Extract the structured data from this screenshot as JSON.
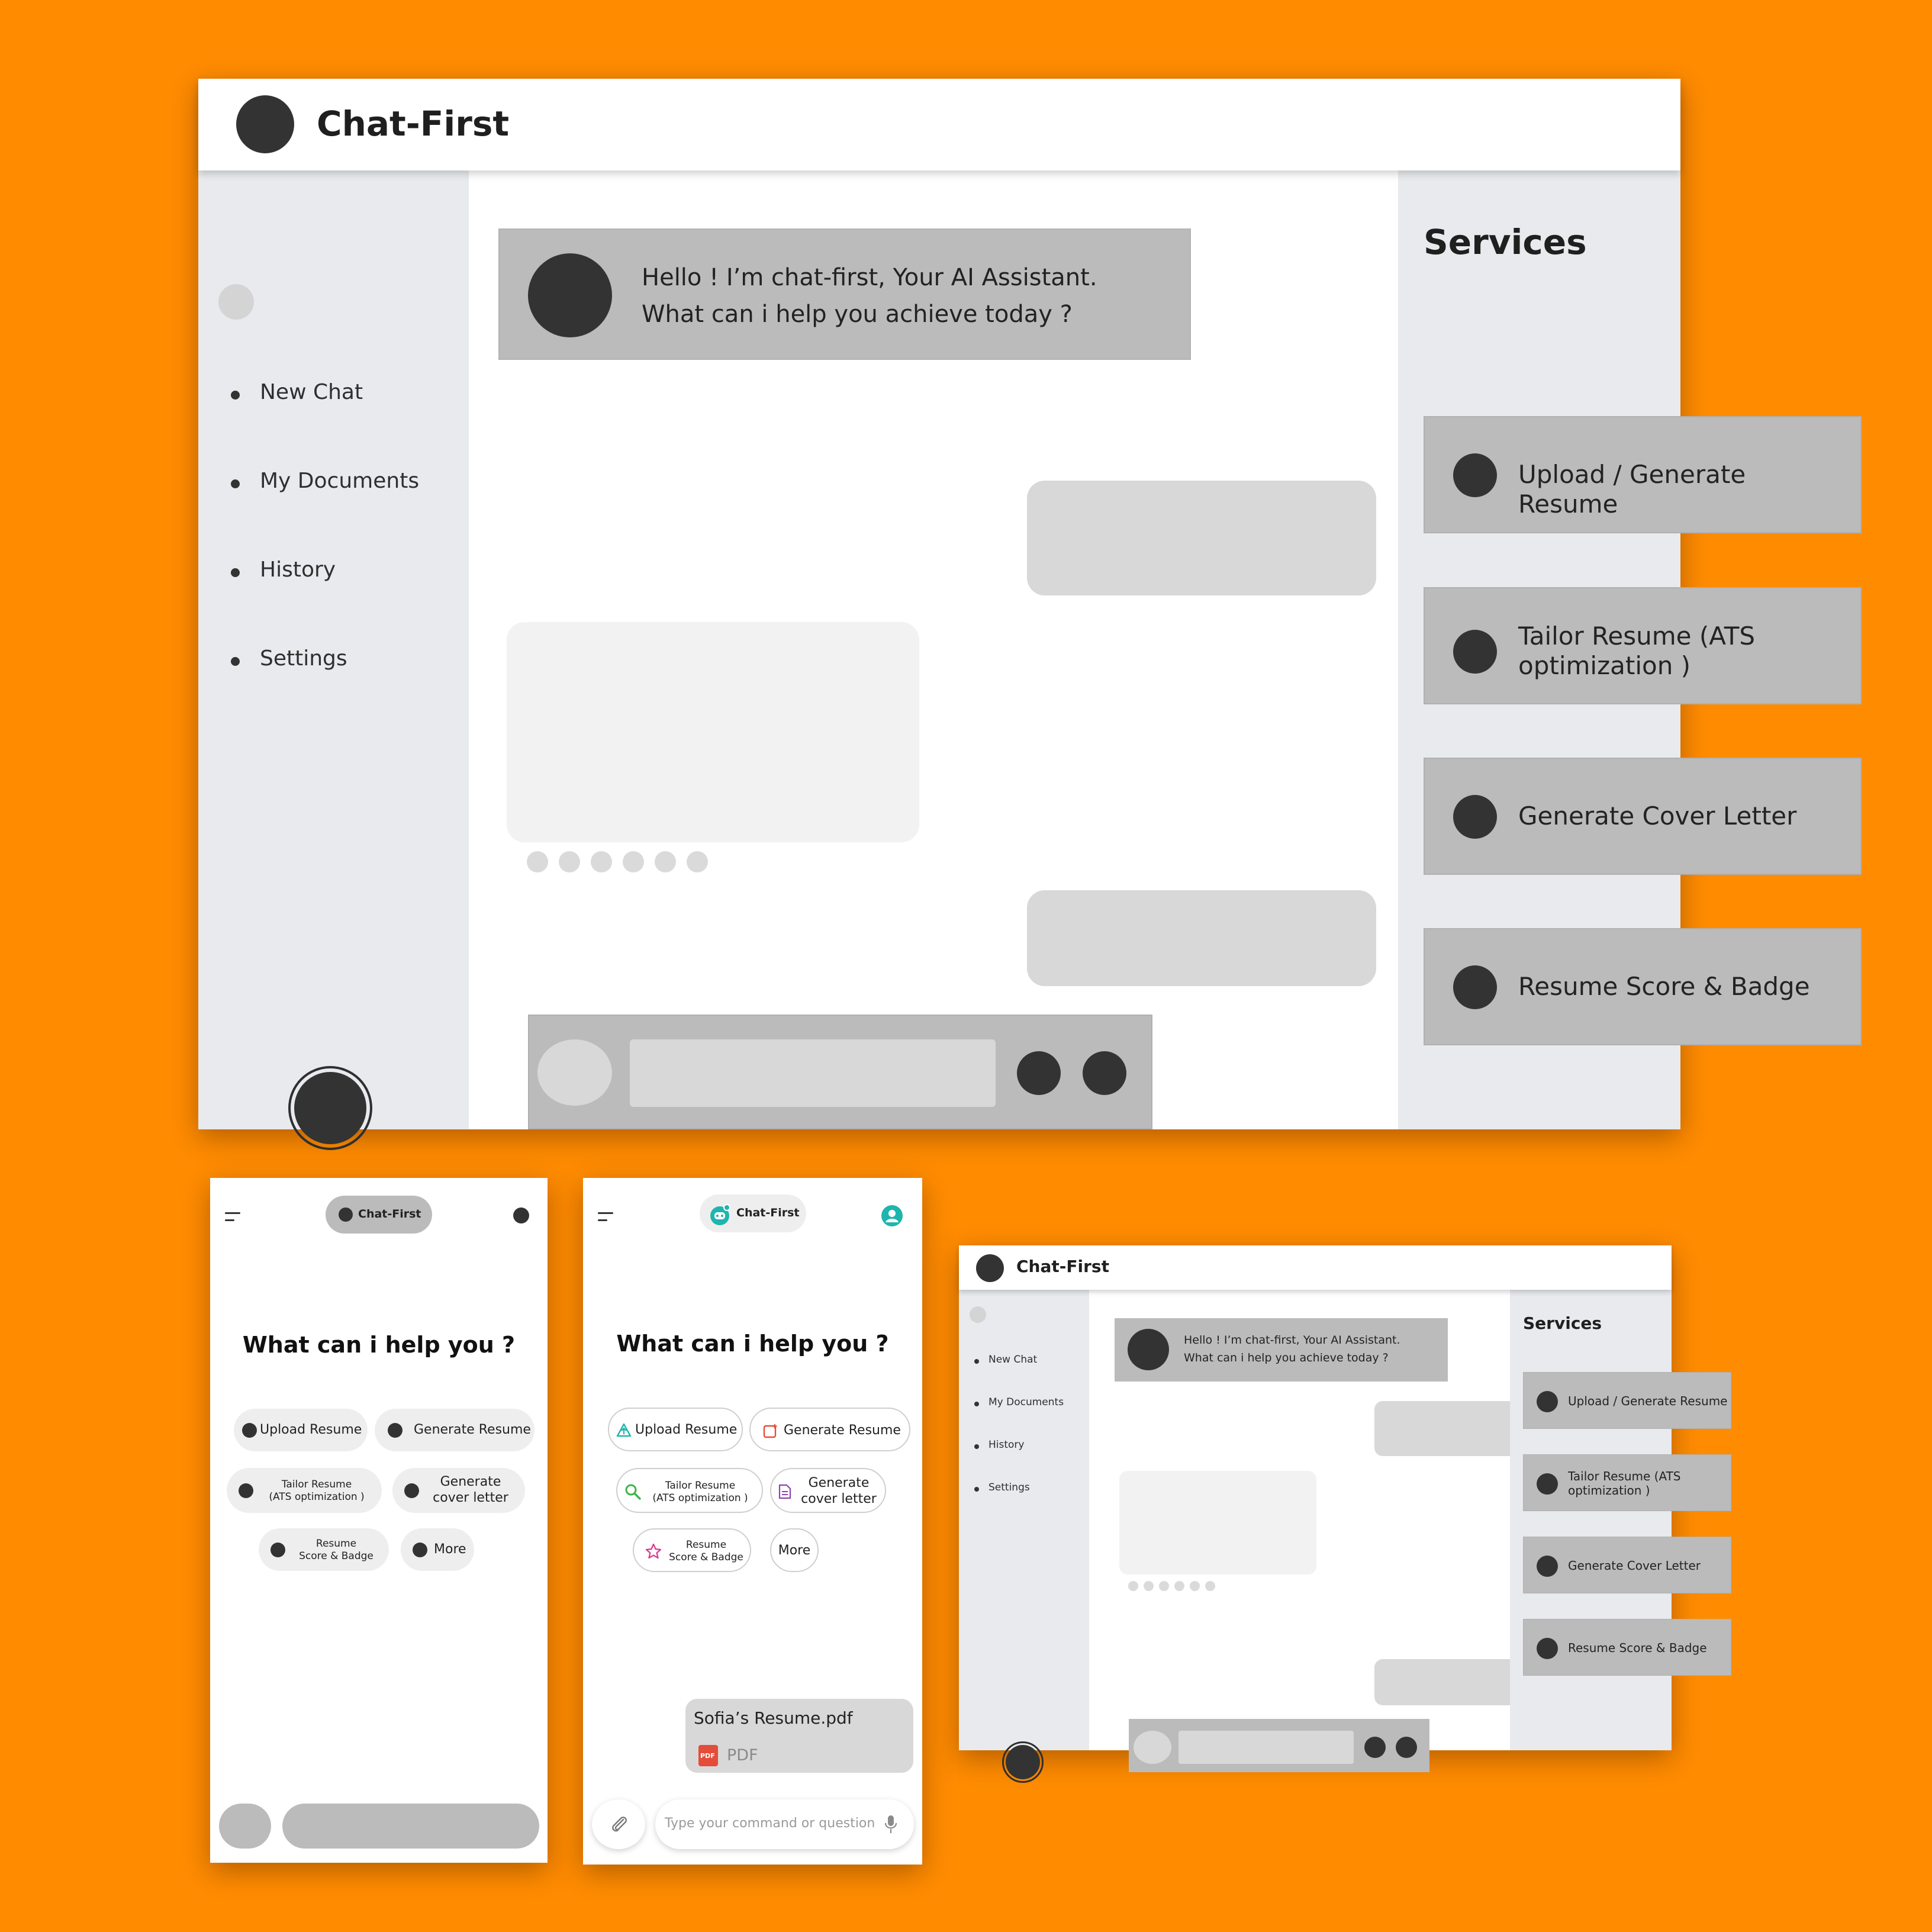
{
  "brand": "Chat-First",
  "sidebar": {
    "items": [
      {
        "label": "New Chat"
      },
      {
        "label": "My Documents"
      },
      {
        "label": "History"
      },
      {
        "label": "Settings"
      }
    ]
  },
  "greeting": {
    "line1": "Hello ! I’m  chat-first, Your AI Assistant.",
    "line2": "What can i help you achieve today ?"
  },
  "services": {
    "title": "Services",
    "items": [
      {
        "line1": "Upload / Generate Resume",
        "line2": ""
      },
      {
        "line1": "Tailor Resume (ATS",
        "line2": "optimization )"
      },
      {
        "line1": "Generate Cover Letter",
        "line2": ""
      },
      {
        "line1": "Resume Score & Badge",
        "line2": ""
      }
    ]
  },
  "mobile": {
    "question": "What can i help you ?",
    "chips": [
      {
        "line1": "Upload Resume",
        "line2": ""
      },
      {
        "line1": "Generate Resume",
        "line2": ""
      },
      {
        "line1": "Tailor Resume",
        "line2": "(ATS optimization )"
      },
      {
        "line1": "Generate",
        "line2": "cover letter"
      },
      {
        "line1": "Resume",
        "line2": "Score & Badge"
      },
      {
        "line1": "More",
        "line2": ""
      }
    ],
    "attachment": {
      "filename": "Sofia’s Resume.pdf",
      "filetype": "PDF",
      "icon_text": "PDF"
    },
    "input_placeholder": "Type your command or question"
  },
  "colors": {
    "background": "#ff8c00",
    "placeholder_dark": "#333333",
    "accent_teal": "#1fb5ad",
    "accent_red": "#e44d3a",
    "accent_green": "#3cb44b",
    "accent_purple": "#8e44ad",
    "accent_pink": "#e0348f"
  },
  "icons": {
    "menu": "hamburger-icon",
    "attach": "paperclip-icon",
    "mic": "microphone-icon",
    "user": "user-icon",
    "upload": "upload-cloud-icon",
    "generate": "document-plus-icon",
    "search": "magnifier-icon",
    "letter": "document-icon",
    "star": "star-icon"
  }
}
